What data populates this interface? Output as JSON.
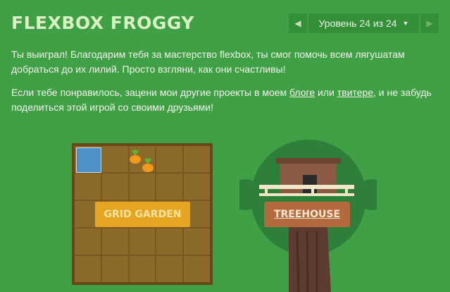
{
  "header": {
    "title": "FLEXBOX FROGGY"
  },
  "level_nav": {
    "prev_icon": "◀",
    "next_icon": "▶",
    "label": "Уровень 24 из 24",
    "caret": "▼"
  },
  "message": {
    "paragraph1": "Ты выиграл! Благодарим тебя за мастерство flexbox, ты смог помочь всем лягушатам добраться до их лилий. Просто взгляни, как они счастливы!",
    "p2_before": "Если тебе понравилось, зацени мои другие проекты в моем ",
    "blog_link": "блоге",
    "p2_between": " или ",
    "twitter_link": "твитере",
    "p2_after": ", и не забудь поделиться этой игрой со своими друзьями!"
  },
  "projects": {
    "grid_garden_label": "GRID GARDEN",
    "treehouse_label": "TREEHOUSE"
  },
  "colors": {
    "background": "#3fa045",
    "garden_button": "#e5a520",
    "treehouse_button": "#b56a3e"
  }
}
